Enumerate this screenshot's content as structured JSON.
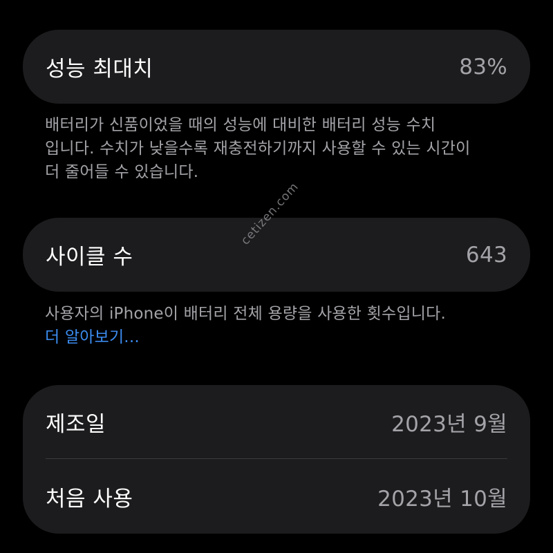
{
  "max_capacity": {
    "label": "성능 최대치",
    "value": "83%",
    "description_lines": [
      "배터리가 신품이었을 때의 성능에 대비한 배터리 성능 수치",
      "입니다. 수치가 낮을수록 재충전하기까지 사용할 수 있는 시간이",
      "더 줄어들 수 있습니다."
    ]
  },
  "cycle_count": {
    "label": "사이클 수",
    "value": "643",
    "description": "사용자의 iPhone이 배터리 전체 용량을 사용한 횟수입니다.",
    "learn_more": "더 알아보기..."
  },
  "dates": {
    "manufacture": {
      "label": "제조일",
      "value": "2023년 9월"
    },
    "first_use": {
      "label": "처음 사용",
      "value": "2023년 10월"
    }
  },
  "watermark": "cetizen.com",
  "colors": {
    "background": "#000000",
    "card": "#1c1c1e",
    "primary_text": "#ffffff",
    "secondary_text": "#a3a3a8",
    "link": "#3b8cf0",
    "divider": "#3a3a3c"
  }
}
